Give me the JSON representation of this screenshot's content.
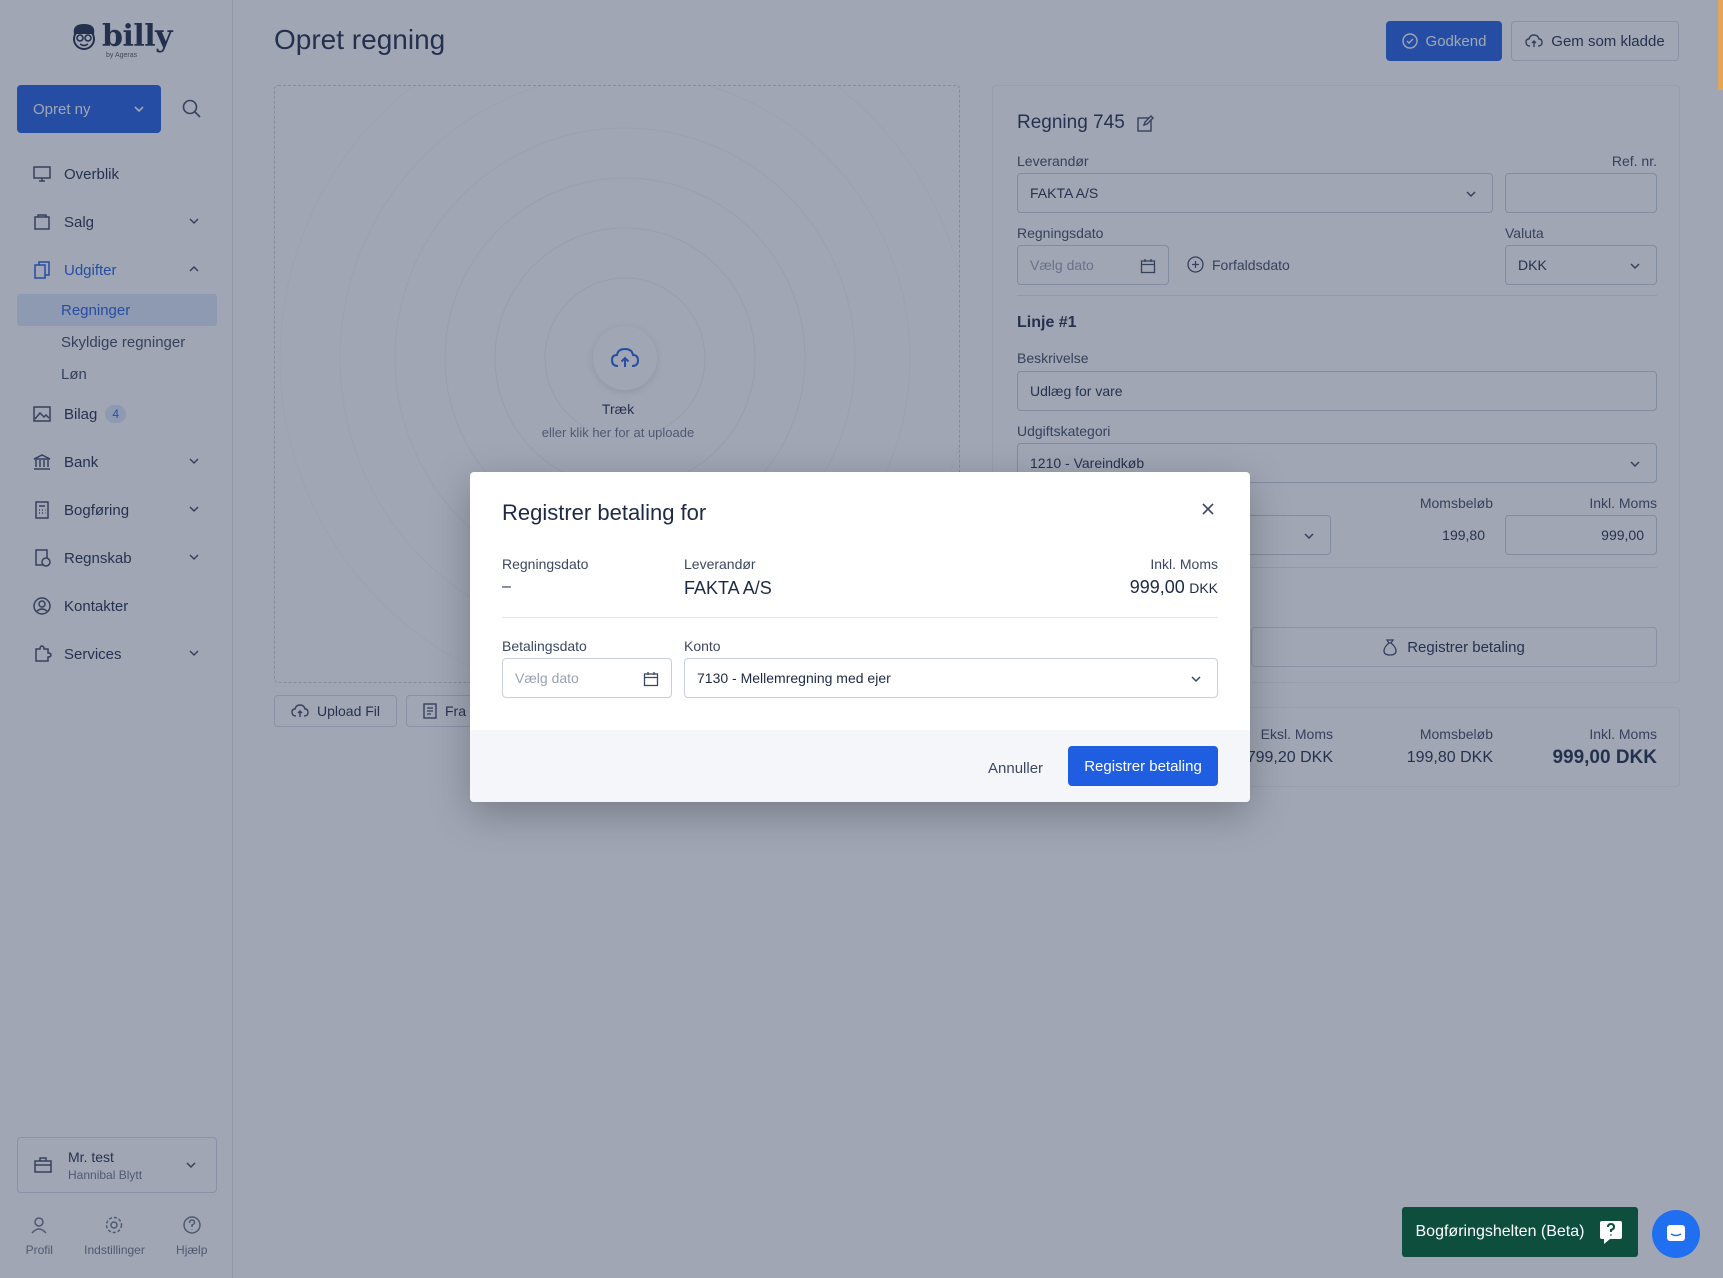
{
  "sidebar": {
    "logo_text": "billy",
    "logo_sub": "by Ageras",
    "create_label": "Opret ny",
    "nav": [
      {
        "label": "Overblik"
      },
      {
        "label": "Salg"
      },
      {
        "label": "Udgifter"
      },
      {
        "label": "Bilag",
        "badge": "4"
      },
      {
        "label": "Bank"
      },
      {
        "label": "Bogføring"
      },
      {
        "label": "Regnskab"
      },
      {
        "label": "Kontakter"
      },
      {
        "label": "Services"
      }
    ],
    "udgifter_sub": [
      "Regninger",
      "Skyldige regninger",
      "Løn"
    ],
    "user": {
      "name": "Mr. test",
      "company": "Hannibal Blytt"
    },
    "footer": [
      "Profil",
      "Indstillinger",
      "Hjælp"
    ]
  },
  "header": {
    "title": "Opret regning",
    "approve_label": "Godkend",
    "draft_label": "Gem som kladde"
  },
  "upload": {
    "title": "Træk",
    "subtitle": "eller klik her for at uploade",
    "upload_file_label": "Upload Fil",
    "from_label": "Fra"
  },
  "bill": {
    "title": "Regning 745",
    "supplier_label": "Leverandør",
    "supplier_value": "FAKTA A/S",
    "ref_label": "Ref. nr.",
    "ref_value": "",
    "date_label": "Regningsdato",
    "date_placeholder": "Vælg dato",
    "due_label": "Forfaldsdato",
    "currency_label": "Valuta",
    "currency_value": "DKK",
    "line_title": "Linje #1",
    "desc_label": "Beskrivelse",
    "desc_value": "Udlæg for vare",
    "category_label": "Udgiftskategori",
    "category_value": "1210 -  Vareindkøb",
    "vat_amount_label": "Momsbeløb",
    "vat_amount_value": "199,80",
    "incl_vat_label": "Inkl. Moms",
    "incl_vat_value": "999,00",
    "register_payment_label": "Registrer betaling"
  },
  "totals": {
    "excl_label": "Eksl. Moms",
    "excl_value": "799,20 DKK",
    "vat_label": "Momsbeløb",
    "vat_value": "199,80 DKK",
    "incl_label": "Inkl. Moms",
    "incl_value": "999,00 DKK"
  },
  "modal": {
    "title": "Registrer betaling for",
    "bill_date_label": "Regningsdato",
    "bill_date_value": "–",
    "supplier_label": "Leverandør",
    "supplier_value": "FAKTA A/S",
    "incl_label": "Inkl. Moms",
    "incl_value": "999,00",
    "incl_currency": "DKK",
    "pay_date_label": "Betalingsdato",
    "pay_date_placeholder": "Vælg dato",
    "account_label": "Konto",
    "account_value": "7130 -  Mellemregning med ejer",
    "cancel_label": "Annuller",
    "submit_label": "Registrer betaling"
  },
  "assistant_label": "Bogføringshelten (Beta)",
  "colors": {
    "primary": "#1f5ee0",
    "assistant": "#0d4f3c",
    "overlay": "#2d3a58"
  }
}
